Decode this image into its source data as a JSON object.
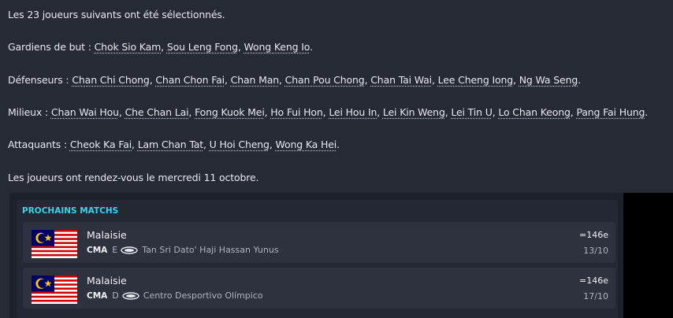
{
  "intro": "Les 23 joueurs suivants ont été sélectionnés.",
  "groups": [
    {
      "label": "Gardiens de but : ",
      "players": [
        "Chok Sio Kam",
        "Sou Leng Fong",
        "Wong Keng Io"
      ]
    },
    {
      "label": "Défenseurs : ",
      "players": [
        "Chan Chi Chong",
        "Chan Chon Fai",
        "Chan Man",
        "Chan Pou Chong",
        "Chan Tai Wai",
        "Lee Cheng Iong",
        "Ng Wa Seng"
      ]
    },
    {
      "label": "Milieux : ",
      "players": [
        "Chan Wai Hou",
        "Che Chan Lai",
        "Fong Kuok Mei",
        "Ho Fui Hon",
        "Lei Hou In",
        "Lei Kin Weng",
        "Lei Tin U",
        "Lo Chan Keong",
        "Pang Fai Hung"
      ]
    },
    {
      "label": "Attaquants : ",
      "players": [
        "Cheok Ka Fai",
        "Lam Chan Tat",
        "U Hoi Cheng",
        "Wong Ka Hei"
      ]
    }
  ],
  "meeting": "Les joueurs ont rendez-vous le mercredi 11 octobre.",
  "upcoming": {
    "title": "PROCHAINS MATCHS",
    "matches": [
      {
        "opponent": "Malaisie",
        "competition": "CMA",
        "venue_type": "E",
        "stadium": "Tan Sri Dato' Haji Hassan Yunus",
        "rank": "=146e",
        "date": "13/10",
        "flag_icon": "malaysia-flag-icon"
      },
      {
        "opponent": "Malaisie",
        "competition": "CMA",
        "venue_type": "D",
        "stadium": "Centro Desportivo Olímpico",
        "rank": "=146e",
        "date": "17/10",
        "flag_icon": "malaysia-flag-icon"
      }
    ]
  },
  "colors": {
    "background": "#262a35",
    "accent": "#3fd2e6",
    "flag_red": "#cc0001",
    "flag_blue": "#010066",
    "flag_yellow": "#ffcc00"
  }
}
